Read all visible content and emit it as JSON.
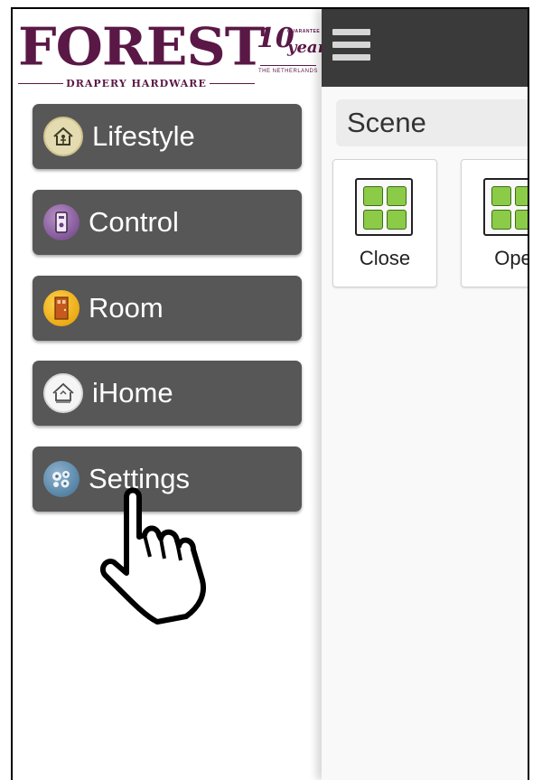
{
  "brand": {
    "name": "FOREST",
    "tagline": "DRAPERY HARDWARE",
    "badge_number": "10",
    "badge_guarantee": "GUARANTEE",
    "badge_year": "year",
    "badge_country": "THE NETHERLANDS",
    "color": "#5a1846"
  },
  "menu": {
    "items": [
      {
        "label": "Lifestyle",
        "icon": "house-icon"
      },
      {
        "label": "Control",
        "icon": "remote-icon"
      },
      {
        "label": "Room",
        "icon": "door-icon"
      },
      {
        "label": "iHome",
        "icon": "ihome-icon"
      },
      {
        "label": "Settings",
        "icon": "gears-icon"
      }
    ],
    "button_color": "#575757"
  },
  "main": {
    "section_title": "Scene",
    "scenes": [
      {
        "label": "Close",
        "icon": "scene-grid-icon"
      },
      {
        "label": "Ope",
        "icon": "scene-grid-icon"
      }
    ],
    "accent": "#8bcb47"
  }
}
